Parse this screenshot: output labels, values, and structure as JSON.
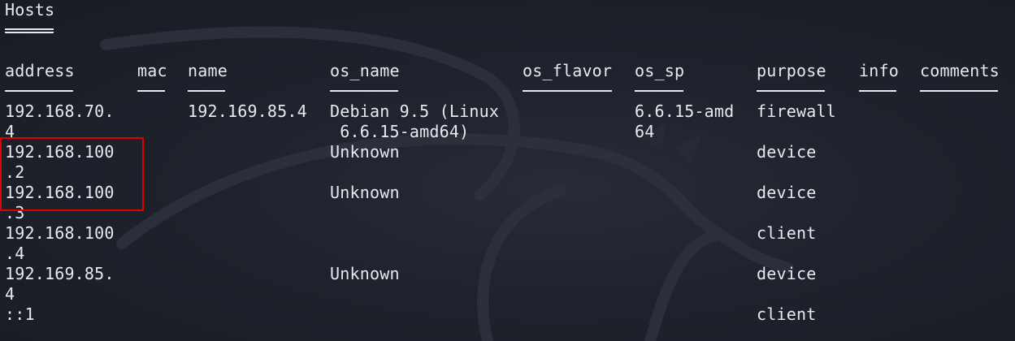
{
  "title": "Hosts",
  "columns": [
    "address",
    "mac",
    "name",
    "os_name",
    "os_flavor",
    "os_sp",
    "purpose",
    "info",
    "comments"
  ],
  "rows": [
    {
      "address_l1": "192.168.70.",
      "address_l2": "4",
      "mac": "",
      "name": "192.169.85.4",
      "os_name_l1": "Debian 9.5 (Linux",
      "os_name_l2": " 6.6.15-amd64)",
      "os_flavor": "",
      "os_sp_l1": "6.6.15-amd",
      "os_sp_l2": "64",
      "purpose": "firewall",
      "info": "",
      "comments": ""
    },
    {
      "address_l1": "192.168.100",
      "address_l2": ".2",
      "mac": "",
      "name": "",
      "os_name_l1": "Unknown",
      "os_name_l2": "",
      "os_flavor": "",
      "os_sp_l1": "",
      "os_sp_l2": "",
      "purpose": "device",
      "info": "",
      "comments": ""
    },
    {
      "address_l1": "192.168.100",
      "address_l2": ".3",
      "mac": "",
      "name": "",
      "os_name_l1": "Unknown",
      "os_name_l2": "",
      "os_flavor": "",
      "os_sp_l1": "",
      "os_sp_l2": "",
      "purpose": "device",
      "info": "",
      "comments": ""
    },
    {
      "address_l1": "192.168.100",
      "address_l2": ".4",
      "mac": "",
      "name": "",
      "os_name_l1": "",
      "os_name_l2": "",
      "os_flavor": "",
      "os_sp_l1": "",
      "os_sp_l2": "",
      "purpose": "client",
      "info": "",
      "comments": ""
    },
    {
      "address_l1": "192.169.85.",
      "address_l2": "4",
      "mac": "",
      "name": "",
      "os_name_l1": "Unknown",
      "os_name_l2": "",
      "os_flavor": "",
      "os_sp_l1": "",
      "os_sp_l2": "",
      "purpose": "device",
      "info": "",
      "comments": ""
    },
    {
      "address_l1": "::1",
      "address_l2": "",
      "mac": "",
      "name": "",
      "os_name_l1": "",
      "os_name_l2": "",
      "os_flavor": "",
      "os_sp_l1": "",
      "os_sp_l2": "",
      "purpose": "client",
      "info": "",
      "comments": ""
    }
  ],
  "colors": {
    "background": "#1b1f29",
    "text": "#e7e9ee",
    "highlight": "#e00000"
  },
  "watermark_icon": "kali-dragon-icon"
}
